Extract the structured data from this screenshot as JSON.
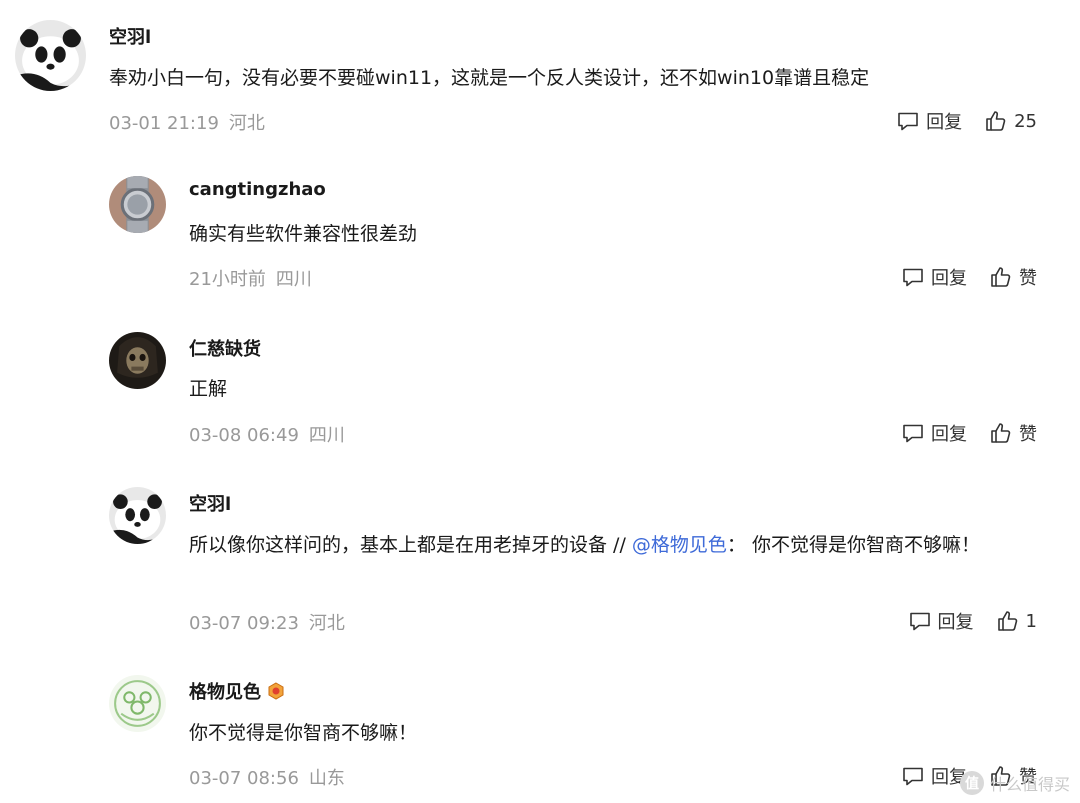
{
  "comments": [
    {
      "username": "空羽l",
      "text": "奉劝小白一句，没有必要不要碰win11，这就是一个反人类设计，还不如win10靠谱且稳定",
      "time": "03-01 21:19",
      "location": "河北",
      "reply_label": "回复",
      "like_label": "25",
      "avatar_icon": "panda-avatar"
    },
    {
      "username": "cangtingzhao",
      "text": "确实有些软件兼容性很差劲",
      "time": "21小时前",
      "location": "四川",
      "reply_label": "回复",
      "like_label": "赞",
      "avatar_icon": "watch-avatar"
    },
    {
      "username": "仁慈缺货",
      "text": "正解",
      "time": "03-08 06:49",
      "location": "四川",
      "reply_label": "回复",
      "like_label": "赞",
      "avatar_icon": "skull-avatar"
    },
    {
      "username": "空羽l",
      "text_before": "所以像你这样问的，基本上都是在用老掉牙的设备 // ",
      "mention": "@格物见色",
      "text_after": "： 你不觉得是你智商不够嘛！",
      "time": "03-07 09:23",
      "location": "河北",
      "reply_label": "回复",
      "like_label": "1",
      "avatar_icon": "panda-avatar"
    },
    {
      "username": "格物见色",
      "text": "你不觉得是你智商不够嘛！",
      "time": "03-07 08:56",
      "location": "山东",
      "reply_label": "回复",
      "like_label": "赞",
      "avatar_icon": "green-pattern-avatar",
      "badge_icon": "level-badge-icon"
    }
  ],
  "watermark": {
    "logo_text": "值",
    "text": "什么值得买"
  },
  "colors": {
    "mention": "#3e6ad8",
    "meta": "#999999",
    "text": "#1a1a1a"
  }
}
